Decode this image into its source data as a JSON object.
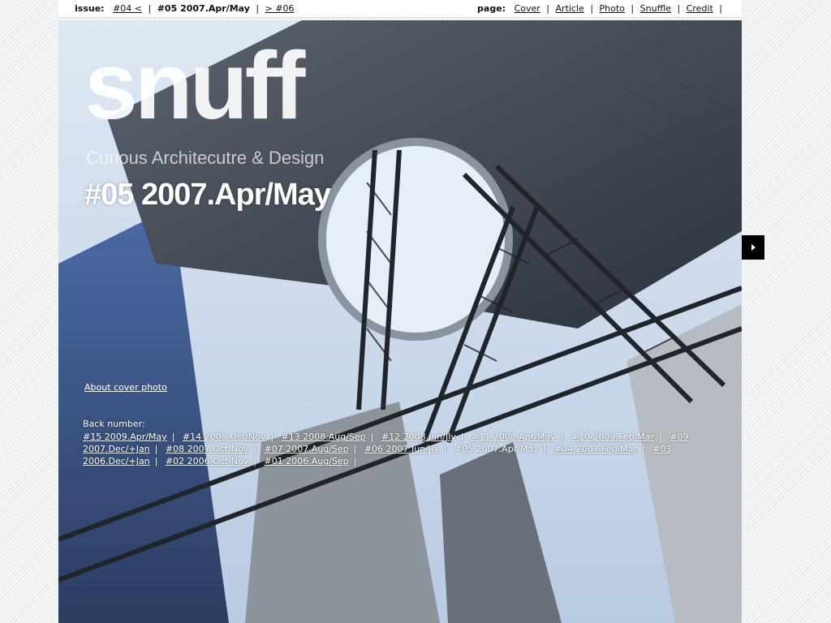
{
  "topbar": {
    "issue_label": "issue:",
    "prev_issue": "#04 <",
    "current_issue": "#05 2007.Apr/May",
    "next_issue": "> #06",
    "page_label": "page:",
    "pages": [
      "Cover",
      "Article",
      "Photo",
      "Snuffle",
      "Credit"
    ]
  },
  "logo": {
    "word": "snuff",
    "tagline": "Curious Architecutre & Design"
  },
  "issue_title": "#05 2007.Apr/May",
  "about_link": "About cover photo",
  "back_number": {
    "label": "Back number:",
    "items": [
      {
        "text": "#15 2009.Apr/May",
        "current": false
      },
      {
        "text": "#14 2008.Oct/Nov",
        "current": false
      },
      {
        "text": "#13 2008.Aug/Sep",
        "current": false
      },
      {
        "text": "#12 2008.Jun/Jly",
        "current": false
      },
      {
        "text": "#11 2008.Apr/May",
        "current": false
      },
      {
        "text": "#10 2008.Feb/Mar",
        "current": false
      },
      {
        "text": "#09 2007.Dec/+Jan",
        "current": false
      },
      {
        "text": "#08 2007.Oct/Nov",
        "current": false
      },
      {
        "text": "#07 2007.Aug/Sep",
        "current": false
      },
      {
        "text": "#06 2007.Jun/Jly",
        "current": false
      },
      {
        "text": "#05 2007.Apr/May",
        "current": true
      },
      {
        "text": "#04 2007.Feb/Mar",
        "current": false
      },
      {
        "text": "#03 2006.Dec/+Jan",
        "current": false
      },
      {
        "text": "#02 2006.Oct/Nov",
        "current": false
      },
      {
        "text": "#01 2006.Aug/Sep",
        "current": false
      }
    ]
  },
  "icons": {
    "next": "triangle-right-icon"
  }
}
